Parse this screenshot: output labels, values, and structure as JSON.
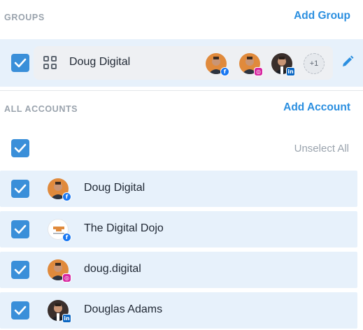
{
  "groups": {
    "section_label": "GROUPS",
    "add_label": "Add Group",
    "group": {
      "name": "Doug Digital",
      "extra_count": "+1",
      "checked": true
    }
  },
  "accounts": {
    "section_label": "ALL ACCOUNTS",
    "add_label": "Add Account",
    "unselect_label": "Unselect All",
    "items": [
      {
        "name": "Doug Digital",
        "network": "facebook",
        "checked": true
      },
      {
        "name": "The Digital Dojo",
        "network": "facebook",
        "checked": true
      },
      {
        "name": "doug.digital",
        "network": "instagram",
        "checked": true
      },
      {
        "name": "Douglas Adams",
        "network": "linkedin",
        "checked": true
      }
    ]
  },
  "colors": {
    "accent": "#2b8fe0",
    "checkbox": "#3a8fd9",
    "selected_row": "#e7f1fb",
    "facebook": "#1877f2",
    "instagram": "#d6249f",
    "linkedin": "#0a66c2"
  },
  "icons": [
    "check-icon",
    "grid-icon",
    "pencil-icon",
    "facebook-icon",
    "instagram-icon",
    "linkedin-icon"
  ]
}
